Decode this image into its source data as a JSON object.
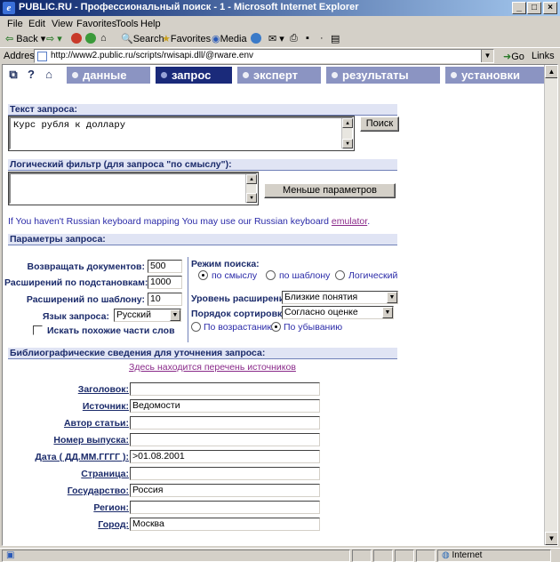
{
  "window": {
    "title": "PUBLIC.RU - Профессиональный поиск - 1 - Microsoft Internet Explorer",
    "minimize": "_",
    "maximize": "□",
    "close": "×"
  },
  "menu": [
    "File",
    "Edit",
    "View",
    "Favorites",
    "Tools",
    "Help"
  ],
  "toolbar": {
    "back": "Back",
    "search": "Search",
    "favorites": "Favorites",
    "media": "Media"
  },
  "address": {
    "label": "Address",
    "url": "http://www2.public.ru/scripts/rwisapi.dll/@rware.env",
    "go": "Go",
    "links": "Links"
  },
  "nav": {
    "icons": [
      "window-icon",
      "help-icon",
      "home-icon"
    ],
    "tabs": [
      {
        "label": "данные",
        "active": false
      },
      {
        "label": "запрос",
        "active": true
      },
      {
        "label": "эксперт",
        "active": false
      },
      {
        "label": "результаты",
        "active": false
      },
      {
        "label": "установки",
        "active": false
      }
    ]
  },
  "query": {
    "heading": "Текст запроса:",
    "value": "Курс рубля к доллару",
    "search_button": "Поиск"
  },
  "logic": {
    "heading": "Логический фильтр (для запроса \"по смыслу\"):",
    "value": "",
    "less_button": "Меньше параметров"
  },
  "hint": {
    "text": "If You haven't Russian keyboard mapping You may use our Russian keyboard",
    "link": "emulator",
    "tail": "."
  },
  "params": {
    "heading": "Параметры запроса:",
    "return_docs_label": "Возвращать документов:",
    "return_docs": "500",
    "subst_label": "Расширений по подстановкам:",
    "subst": "1000",
    "template_label": "Расширений по шаблону:",
    "template": "10",
    "lang_label": "Язык запроса:",
    "lang": "Русский",
    "similar_label": "Искать похожие части слов",
    "mode_label": "Режим поиска:",
    "modes": [
      "по смыслу",
      "по шаблону",
      "Логический"
    ],
    "level_label": "Уровень расширения:",
    "level": "Близкие понятия",
    "sort_label": "Порядок сортировки:",
    "sort": "Согласно оценке",
    "order": [
      "По возрастанию",
      "По убыванию"
    ]
  },
  "biblio": {
    "heading": "Библиографические сведения для уточнения запроса:",
    "sources_link": "Здесь находится перечень источников",
    "fields": [
      {
        "label": "Заголовок:",
        "value": ""
      },
      {
        "label": "Источник:",
        "value": "Ведомости"
      },
      {
        "label": "Автор статьи:",
        "value": ""
      },
      {
        "label": "Номер выпуска:",
        "value": ""
      },
      {
        "label": "Дата ( ДД.ММ.ГГГГ ):",
        "value": ">01.08.2001"
      },
      {
        "label": "Страница:",
        "value": ""
      },
      {
        "label": "Государство:",
        "value": "Россия"
      },
      {
        "label": "Регион:",
        "value": ""
      },
      {
        "label": "Город:",
        "value": "Москва"
      }
    ]
  },
  "status": {
    "zone": "Internet"
  }
}
